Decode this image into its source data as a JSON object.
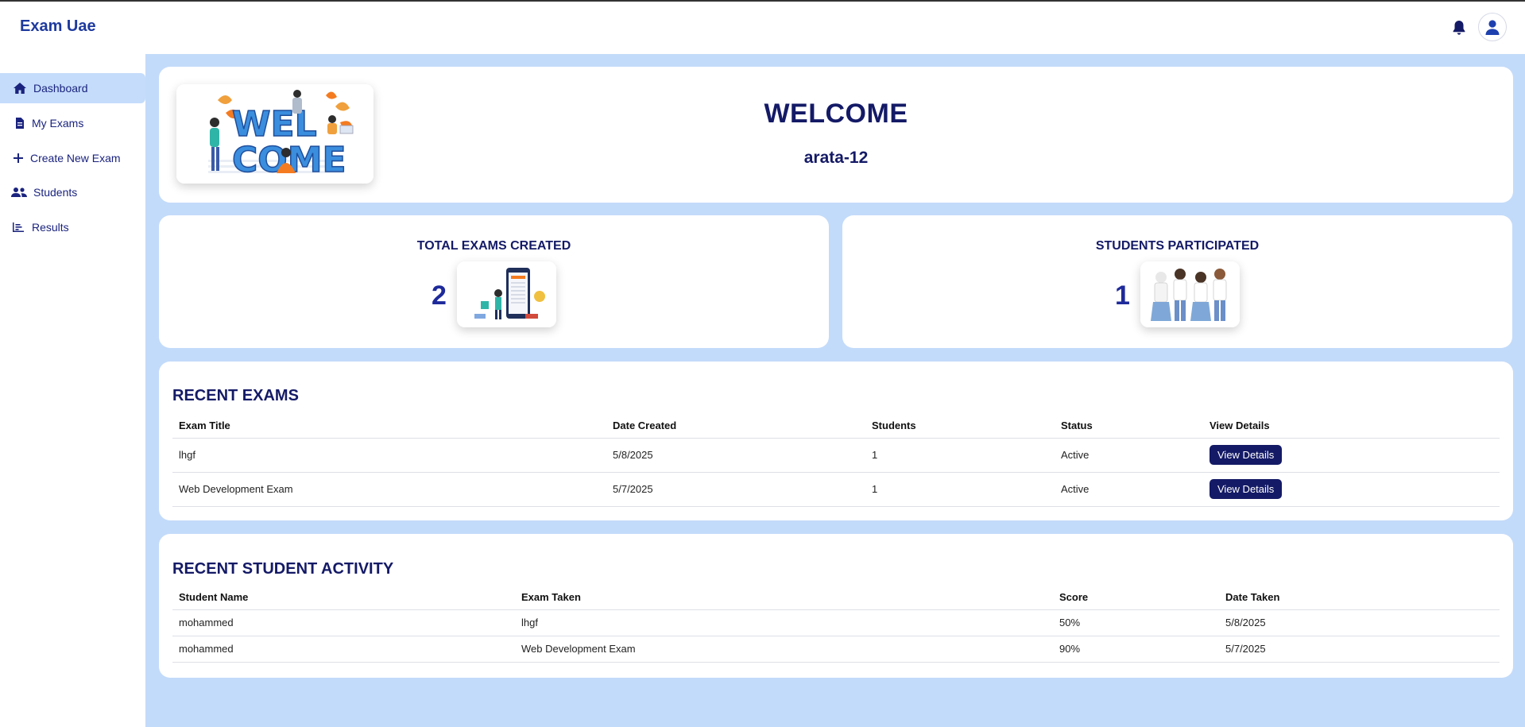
{
  "app": {
    "title": "Exam Uae"
  },
  "header": {
    "bell_icon": "bell-icon",
    "avatar_icon": "user-icon"
  },
  "sidebar": {
    "items": [
      {
        "label": "Dashboard",
        "icon": "home-icon",
        "active": true
      },
      {
        "label": "My Exams",
        "icon": "file-icon",
        "active": false
      },
      {
        "label": "Create New Exam",
        "icon": "plus-icon",
        "active": false
      },
      {
        "label": "Students",
        "icon": "users-icon",
        "active": false
      },
      {
        "label": "Results",
        "icon": "chart-icon",
        "active": false
      }
    ]
  },
  "welcome": {
    "title": "WELCOME",
    "username": "arata-12"
  },
  "stats": {
    "total_exams": {
      "label": "TOTAL EXAMS CREATED",
      "value": "2"
    },
    "students": {
      "label": "STUDENTS PARTICIPATED",
      "value": "1"
    }
  },
  "recent_exams": {
    "title": "RECENT EXAMS",
    "columns": [
      "Exam Title",
      "Date Created",
      "Students",
      "Status",
      "View Details"
    ],
    "rows": [
      {
        "title": "lhgf",
        "date": "5/8/2025",
        "students": "1",
        "status": "Active",
        "action": "View Details"
      },
      {
        "title": "Web Development Exam",
        "date": "5/7/2025",
        "students": "1",
        "status": "Active",
        "action": "View Details"
      }
    ]
  },
  "recent_activity": {
    "title": "RECENT STUDENT ACTIVITY",
    "columns": [
      "Student Name",
      "Exam Taken",
      "Score",
      "Date Taken"
    ],
    "rows": [
      {
        "student": "mohammed",
        "exam": "lhgf",
        "score": "50%",
        "date": "5/8/2025"
      },
      {
        "student": "mohammed",
        "exam": "Web Development Exam",
        "score": "90%",
        "date": "5/7/2025"
      }
    ]
  },
  "colors": {
    "accent": "#141a66",
    "background": "#c3dbfa",
    "brand": "#1e3a9e"
  }
}
